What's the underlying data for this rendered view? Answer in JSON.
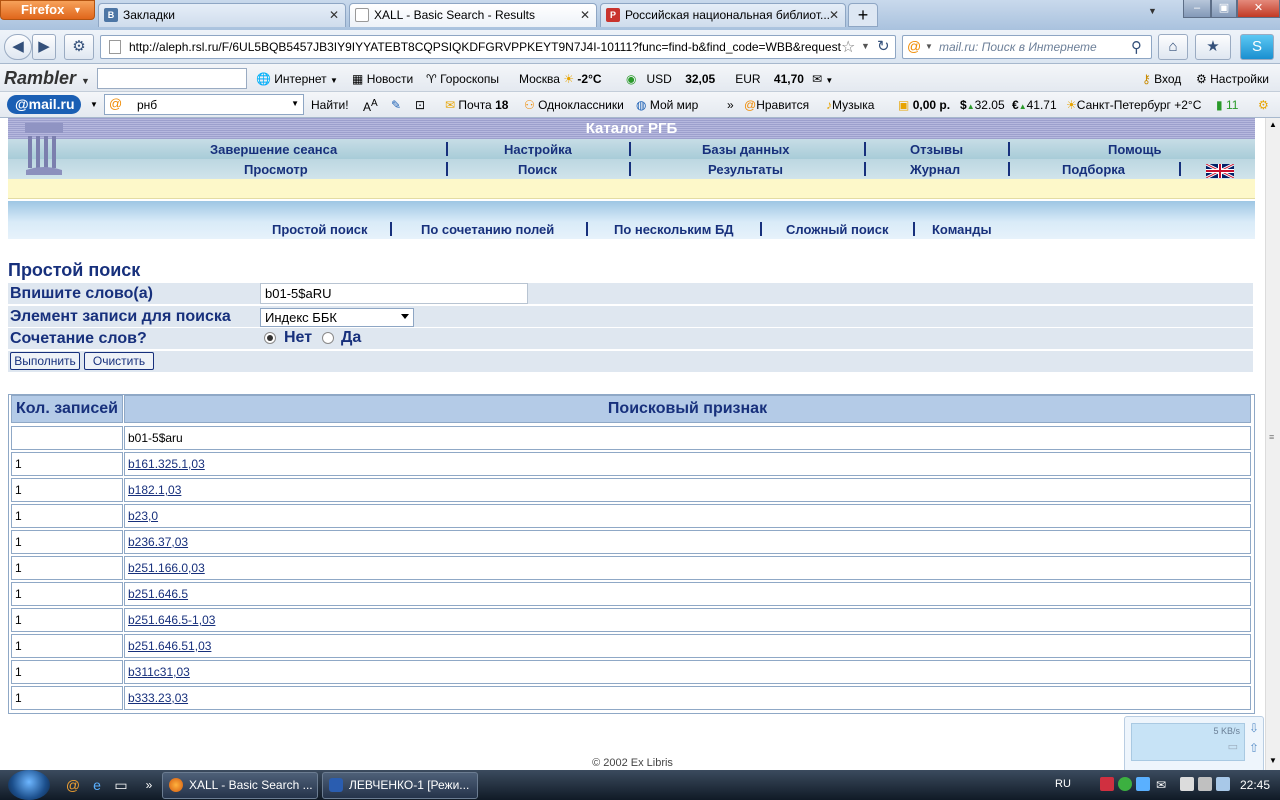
{
  "browser": {
    "firefox_button": "Firefox",
    "tabs": [
      {
        "label": "Закладки"
      },
      {
        "label": "XALL - Basic Search - Results"
      },
      {
        "label": "Российская национальная библиот..."
      }
    ],
    "url": "http://aleph.rsl.ru/F/6UL5BQB5457JB3IY9IYYATEBT8CQPSIQKDFGRVPPKEYT9N7J4I-10111?func=find-b&find_code=WBB&request=b01",
    "search_placeholder": "mail.ru: Поиск в Интернете"
  },
  "rambler_bar": {
    "logo": "Rambler",
    "internet": "Интернет",
    "news": "Новости",
    "horoscopes": "Гороскопы",
    "city": "Москва",
    "temp": "-2°C",
    "usd_label": "USD",
    "usd_value": "32,05",
    "eur_label": "EUR",
    "eur_value": "41,70",
    "login": "Вход",
    "settings": "Настройки"
  },
  "mail_bar": {
    "logo": "@mail.ru",
    "search_value": "рнб",
    "find": "Найти!",
    "mail": "Почта",
    "mail_count": "18",
    "classmates": "Одноклассники",
    "myworld": "Мой мир",
    "like": "Нравится",
    "music": "Музыка",
    "money": "0,00 р.",
    "usd": "32.05",
    "eur": "41.71",
    "weather": "Санкт-Петербург +2°C",
    "traffic": "11"
  },
  "page": {
    "catalog_title": "Каталог РГБ",
    "menu1": [
      "Завершение сеанса",
      "Настройка",
      "Базы данных",
      "Отзывы",
      "Помощь"
    ],
    "menu2": [
      "Просмотр",
      "Поиск",
      "Результаты",
      "Журнал",
      "Подборка"
    ],
    "subnav": [
      "Простой поиск",
      "По сочетанию полей",
      "По нескольким БД",
      "Сложный поиск",
      "Команды"
    ],
    "form": {
      "title": "Простой поиск",
      "word_label": "Впишите слово(а)",
      "word_value": "b01-5$aRU",
      "field_label": "Элемент записи для поиска",
      "field_value": "Индекс ББК",
      "combo_label": "Сочетание слов?",
      "combo_no": "Нет",
      "combo_yes": "Да",
      "combo_selected": "Нет",
      "submit": "Выполнить",
      "clear": "Очистить"
    },
    "results": {
      "col_count": "Кол. записей",
      "col_term": "Поисковый признак",
      "rows": [
        {
          "count": "",
          "term": "b01-5$aru",
          "link": false
        },
        {
          "count": "1",
          "term": "b161.325.1,03",
          "link": true
        },
        {
          "count": "1",
          "term": "b182.1,03",
          "link": true
        },
        {
          "count": "1",
          "term": "b23,0",
          "link": true
        },
        {
          "count": "1",
          "term": "b236.37,03",
          "link": true
        },
        {
          "count": "1",
          "term": "b251.166.0,03",
          "link": true
        },
        {
          "count": "1",
          "term": "b251.646.5",
          "link": true
        },
        {
          "count": "1",
          "term": "b251.646.5-1,03",
          "link": true
        },
        {
          "count": "1",
          "term": "b251.646.51,03",
          "link": true
        },
        {
          "count": "1",
          "term": "b311с31,03",
          "link": true
        },
        {
          "count": "1",
          "term": "b333.23,03",
          "link": true
        }
      ]
    },
    "footer": "© 2002 Ex Libris",
    "download_rate": "5 KB/s"
  },
  "taskbar": {
    "tasks": [
      "XALL - Basic Search ...",
      "ЛЕВЧЕНКО-1 [Режи..."
    ],
    "lang": "RU",
    "clock": "22:45"
  },
  "colors": {
    "link": "#17307c",
    "header_bg": "#b4cbe7",
    "yellow_bar": "#fdf8c9"
  }
}
